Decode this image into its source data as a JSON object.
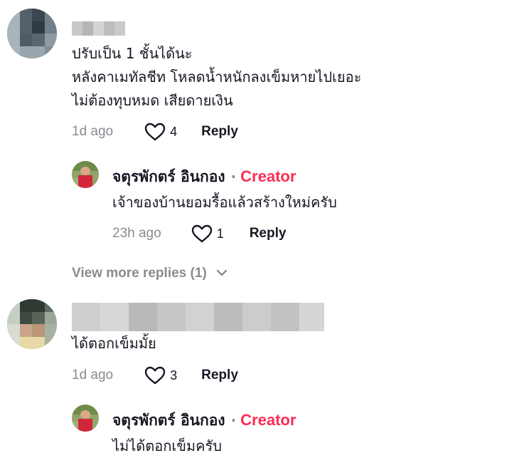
{
  "comments": [
    {
      "text_lines": [
        "ปรับเป็น 1 ชั้นได้นะ",
        "หลังคาเมทัลชีท โหลดน้ำหนักลงเข็มหายไปเยอะ",
        "ไม่ต้องทุบหมด เสียดายเงิน"
      ],
      "time": "1d ago",
      "likes": "4",
      "reply_label": "Reply",
      "reply": {
        "author": "จตุรพักตร์ อินกอง",
        "separator": "·",
        "badge": "Creator",
        "text": "เจ้าของบ้านยอมรื้อแล้วสร้างใหม่ครับ",
        "time": "23h ago",
        "likes": "1",
        "reply_label": "Reply"
      },
      "view_more": "View more replies (1)"
    },
    {
      "text_lines": [
        "ได้ตอกเข็มมั้ย"
      ],
      "time": "1d ago",
      "likes": "3",
      "reply_label": "Reply",
      "reply": {
        "author": "จตุรพักตร์ อินกอง",
        "separator": "·",
        "badge": "Creator",
        "text": "ไม่ได้ตอกเข็มครับ"
      }
    }
  ],
  "colors": {
    "creator_badge": "#fe2c55",
    "muted": "#8a8b91",
    "text": "#161823"
  },
  "icons": {
    "like": "heart-outline-icon",
    "expand": "chevron-down-icon"
  }
}
